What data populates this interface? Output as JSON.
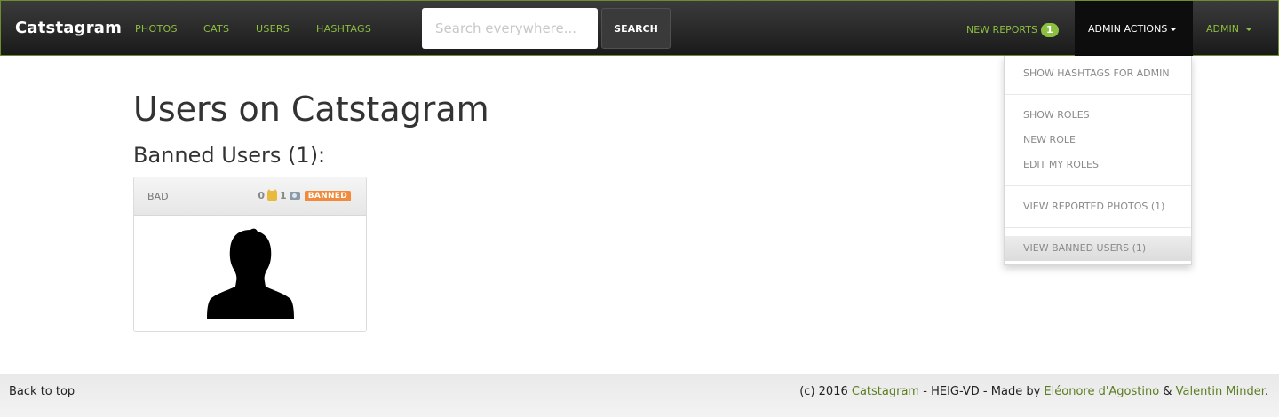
{
  "navbar": {
    "brand": "Catstagram",
    "links": [
      "PHOTOS",
      "CATS",
      "USERS",
      "HASHTAGS"
    ],
    "search_placeholder": "Search everywhere...",
    "search_button": "SEARCH",
    "reports_label": "NEW REPORTS",
    "reports_count": "1",
    "admin_actions_label": "ADMIN ACTIONS",
    "user_label": "ADMIN"
  },
  "dropdown": {
    "items": [
      "SHOW HASHTAGS FOR ADMIN",
      "SHOW ROLES",
      "NEW ROLE",
      "EDIT MY ROLES",
      "VIEW REPORTED PHOTOS (1)",
      "VIEW BANNED USERS (1)"
    ]
  },
  "main": {
    "title": "Users on Catstagram",
    "section_title": "Banned Users (1):",
    "card": {
      "username": "BAD",
      "cats_count": "0",
      "photos_count": "1",
      "badge": "BANNED"
    }
  },
  "footer": {
    "back_to_top": "Back to top",
    "prefix": "(c) 2016",
    "site": "Catstagram",
    "middle": "- HEIG-VD - Made by",
    "author1": "Eléonore d'Agostino",
    "and": "&",
    "author2": "Valentin Minder",
    "end": "."
  },
  "colors": {
    "accent": "#8cbf3f",
    "banned": "#f08a3c"
  }
}
